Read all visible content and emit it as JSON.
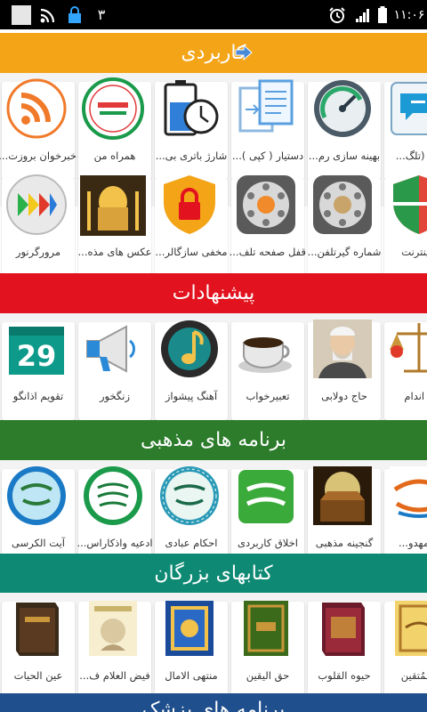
{
  "status_bar": {
    "number": "۳",
    "time": "۱۱:۰۶"
  },
  "colors": {
    "cat_usable": "#f3a417",
    "cat_suggestions": "#e2131e",
    "cat_religious": "#2c7c2c",
    "cat_books": "#0e8a74",
    "cat_medical": "#1f4f8c"
  },
  "sections": [
    {
      "title": "کاربردی",
      "apps": [
        {
          "label": "خبرخوان بروزت...",
          "icon": "rss-icon"
        },
        {
          "label": "همراه من",
          "icon": "hamrah-logo-icon"
        },
        {
          "label": "شارژ باتری بی...",
          "icon": "battery-clock-icon"
        },
        {
          "label": "دستیار ( کپی )...",
          "icon": "copy-documents-icon"
        },
        {
          "label": "بهینه سازی رم...",
          "icon": "speedometer-icon"
        },
        {
          "label": "قفل (تلگ...",
          "icon": "chat-lock-icon"
        },
        {
          "label": "مرورگرنور",
          "icon": "noor-browser-icon"
        },
        {
          "label": "عکس های مذه...",
          "icon": "shrine-photo-icon"
        },
        {
          "label": "مخفی سازگالر...",
          "icon": "padlock-shield-icon"
        },
        {
          "label": "قفل صفحه تلف...",
          "icon": "rotary-phone-lock-icon"
        },
        {
          "label": "شماره گیرتلفن...",
          "icon": "rotary-phone-icon"
        },
        {
          "label": "ر اینترنت",
          "icon": "shield-icon"
        }
      ]
    },
    {
      "title": "پیشنهادات",
      "apps": [
        {
          "label": "تقویم اذانگو",
          "icon": "calendar-29-icon"
        },
        {
          "label": "زنگخور",
          "icon": "megaphone-icon"
        },
        {
          "label": "آهنگ پیشواز",
          "icon": "music-note-icon"
        },
        {
          "label": "تعبیرخواب",
          "icon": "coffee-cup-icon"
        },
        {
          "label": "حاج دولابی",
          "icon": "portrait-icon"
        },
        {
          "label": "ب اندام",
          "icon": "scale-icon"
        }
      ]
    },
    {
      "title": "برنامه های مذهبی",
      "apps": [
        {
          "label": "آیت الکرسی",
          "icon": "ayat-alkursi-icon"
        },
        {
          "label": "ادعیه واذکاراس...",
          "icon": "adieh-icon"
        },
        {
          "label": "احکام عبادی",
          "icon": "ahkam-icon"
        },
        {
          "label": "اخلاق کاربردی",
          "icon": "akhlagh-icon"
        },
        {
          "label": "گنجینه مذهبی",
          "icon": "treasure-chest-icon"
        },
        {
          "label": "مه مهدو...",
          "icon": "mahdavi-calligraphy-icon"
        }
      ]
    },
    {
      "title": "کتابهای بزرگان",
      "apps": [
        {
          "label": "عین الحیات",
          "icon": "book-icon"
        },
        {
          "label": "فیض العلام ف...",
          "icon": "book-portrait-icon"
        },
        {
          "label": "منتهی الامال",
          "icon": "book-blue-icon"
        },
        {
          "label": "حق الیقین",
          "icon": "book-green-icon"
        },
        {
          "label": "حیوه القلوب",
          "icon": "book-red-icon"
        },
        {
          "label": "ه المُتقین",
          "icon": "book-gold-icon"
        }
      ]
    },
    {
      "title": "برنامه های پزشک"
    }
  ]
}
